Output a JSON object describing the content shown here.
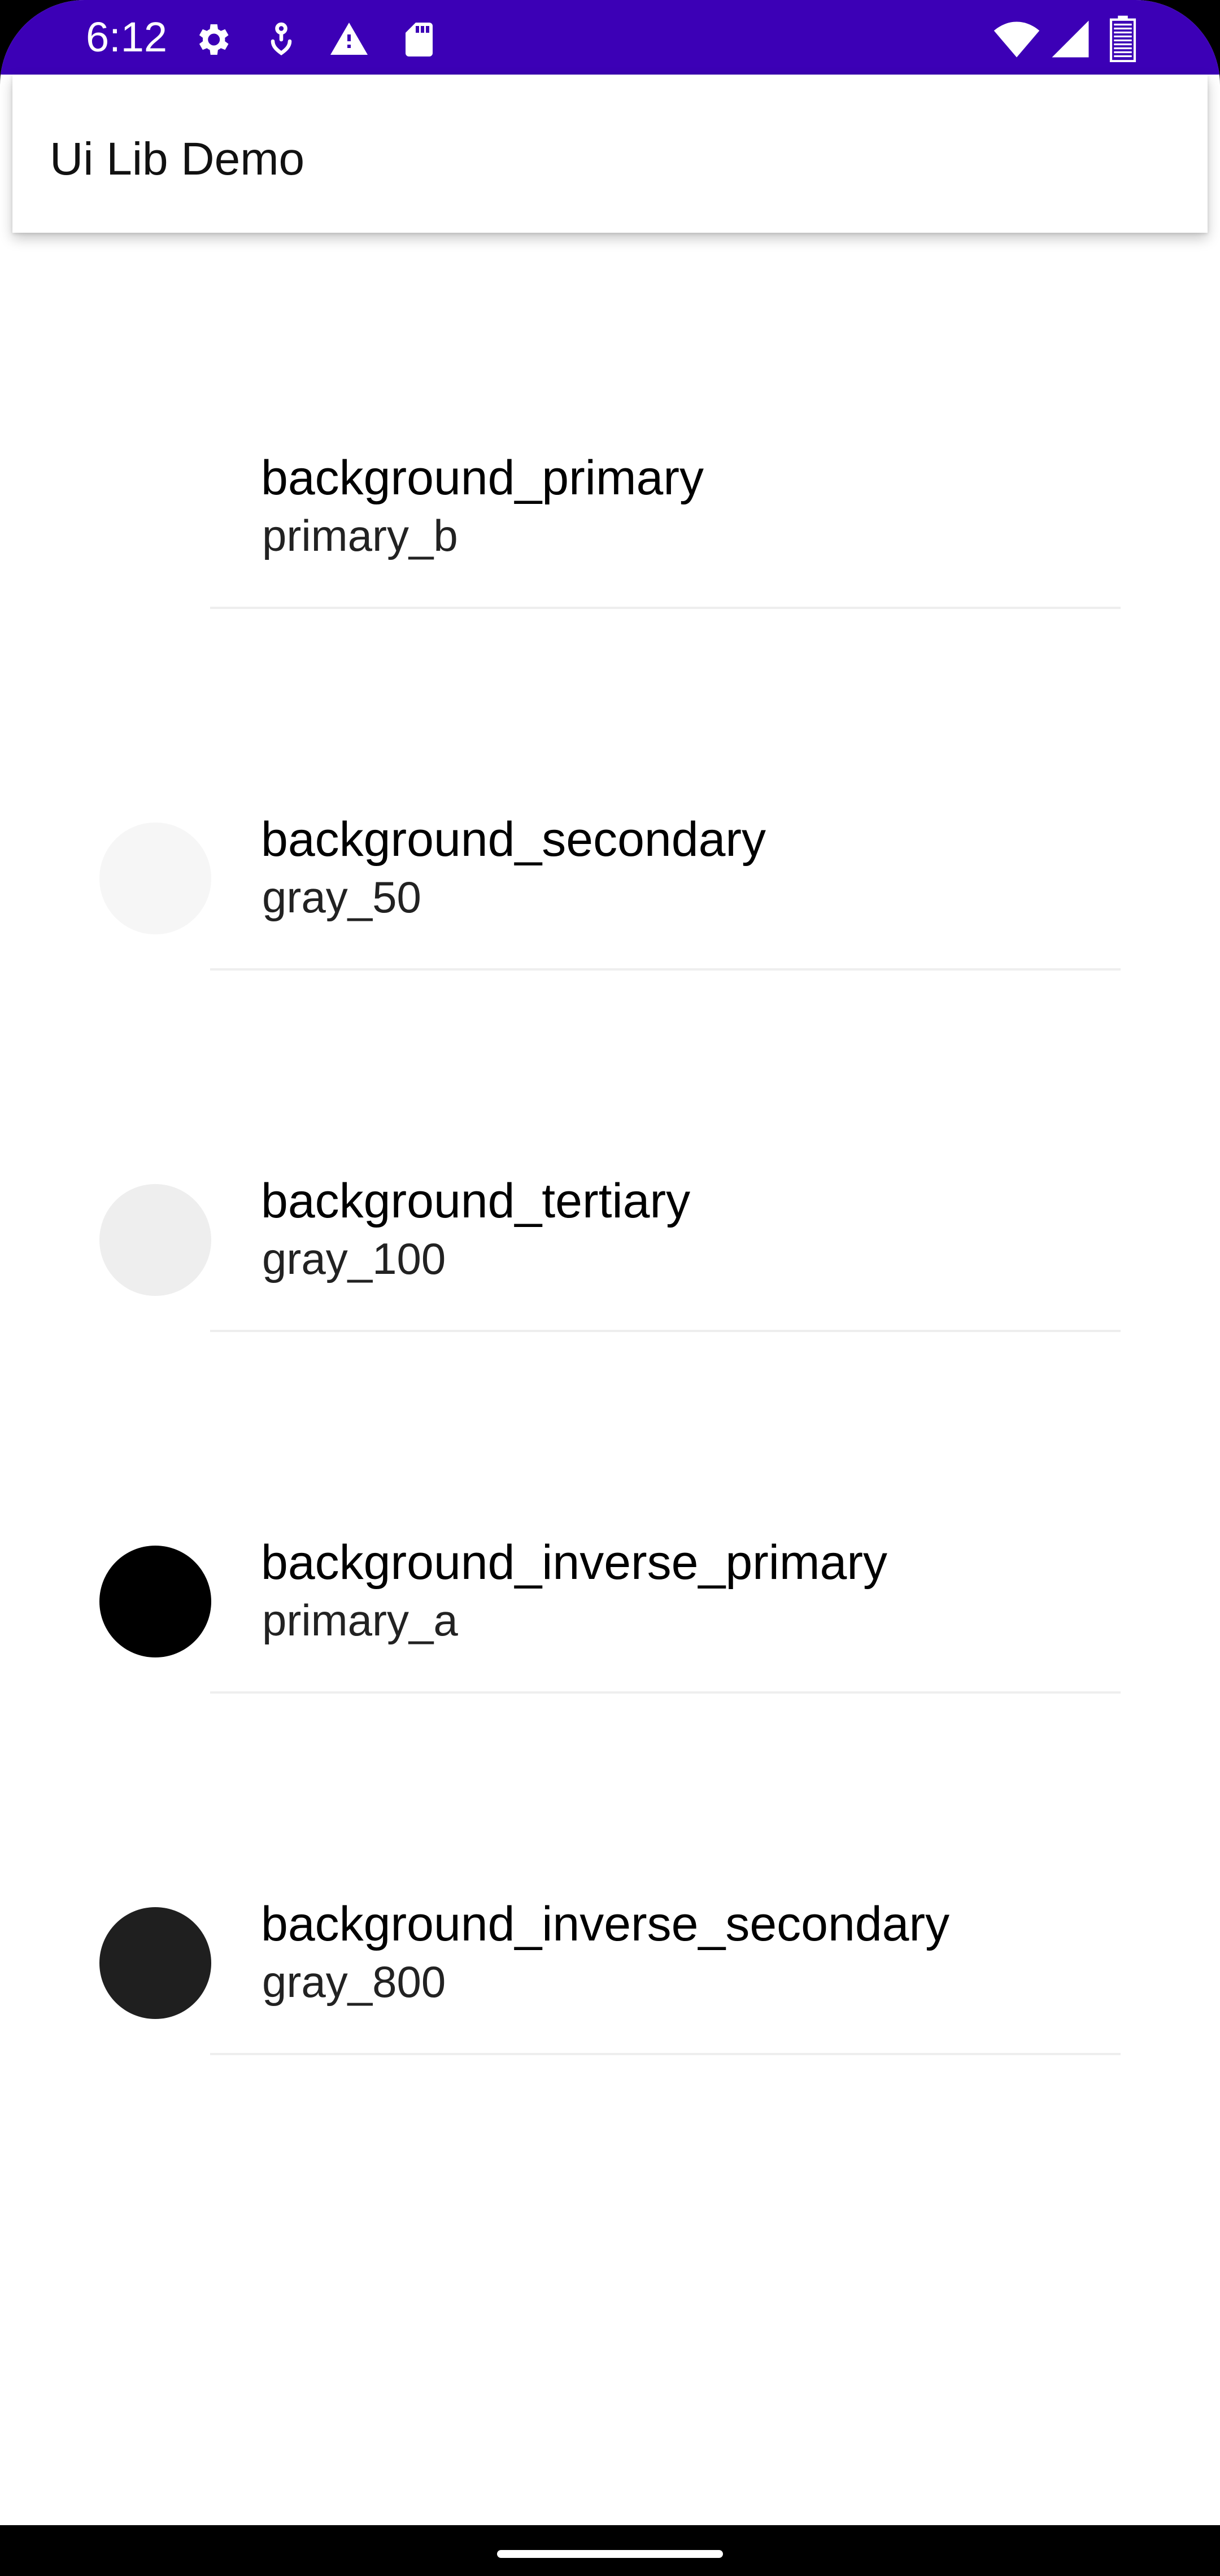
{
  "status_bar": {
    "time": "6:12",
    "left_icons": [
      "gear-icon",
      "usb-debug-icon",
      "warning-icon",
      "sd-card-icon"
    ],
    "right_icons": [
      "wifi-icon",
      "cell-signal-icon",
      "battery-icon"
    ],
    "color": "#3c00b6"
  },
  "app_bar": {
    "title": "Ui Lib Demo"
  },
  "list": {
    "items": [
      {
        "title": "background_primary",
        "subtitle": "primary_b",
        "swatch_color": "#ffffff"
      },
      {
        "title": "background_secondary",
        "subtitle": "gray_50",
        "swatch_color": "#f6f6f6"
      },
      {
        "title": "background_tertiary",
        "subtitle": "gray_100",
        "swatch_color": "#eeeeee"
      },
      {
        "title": "background_inverse_primary",
        "subtitle": "primary_a",
        "swatch_color": "#000000"
      },
      {
        "title": "background_inverse_secondary",
        "subtitle": "gray_800",
        "swatch_color": "#1f1f1f"
      }
    ]
  }
}
